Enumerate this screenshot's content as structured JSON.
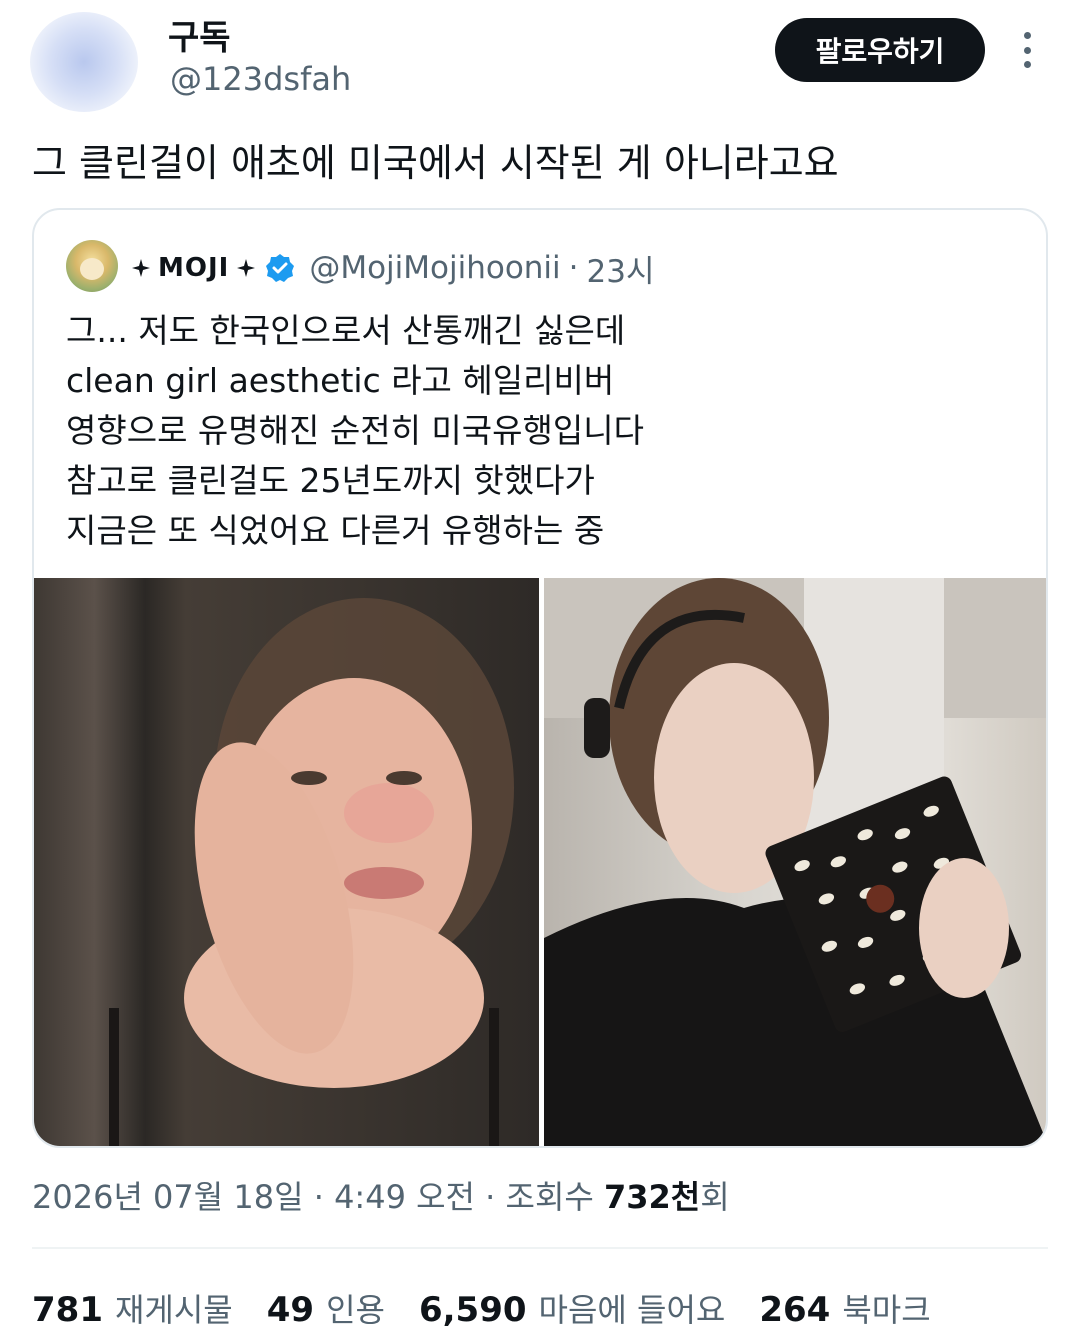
{
  "author": {
    "display_name": "구독",
    "handle": "@123dsfah",
    "follow_label": "팔로우하기",
    "more_icon": "more-vertical-icon"
  },
  "tweet": {
    "text": "그 클린걸이 애초에 미국에서 시작된 게 아니라고요"
  },
  "quoted": {
    "name": "MOJI",
    "name_decoration_icon": "sparkle-star-icon",
    "verified_icon": "verified-badge-icon",
    "verified_color": "#1d9bf0",
    "handle": "@MojiMojihoonii",
    "separator": "·",
    "time": "23시",
    "lines": [
      "그... 저도 한국인으로서 산통깨긴 싫은데",
      "clean girl aesthetic 라고 헤일리비버",
      "영향으로 유명해진 순전히 미국유행입니다",
      "참고로 클린걸도 25년도까지 핫했다가",
      "지금은 또 식었어요 다른거 유행하는 중"
    ]
  },
  "meta": {
    "date": "2026년 07월 18일",
    "sep1": "·",
    "time": "4:49 오전",
    "sep2": "·",
    "views_label": "조회수",
    "views_value": "732천",
    "views_suffix": "회"
  },
  "stats": {
    "reposts": {
      "value": "781",
      "label": "재게시물"
    },
    "quotes": {
      "value": "49",
      "label": "인용"
    },
    "likes": {
      "value": "6,590",
      "label": "마음에 들어요"
    },
    "bookmarks": {
      "value": "264",
      "label": "북마크"
    }
  }
}
